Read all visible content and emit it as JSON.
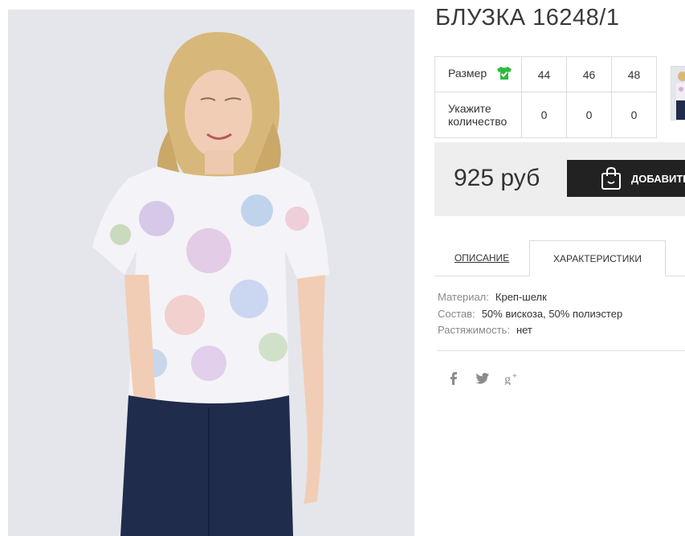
{
  "product": {
    "title": "БЛУЗКА 16248/1",
    "image_alt": "Женщина в блузке с цветочным принтом"
  },
  "sizes": {
    "size_label": "Размер",
    "quantity_label_line1": "Укажите",
    "quantity_label_line2": "количество",
    "values": [
      "44",
      "46",
      "48"
    ],
    "quantities": [
      "0",
      "0",
      "0"
    ],
    "icon": "tshirt-check-icon",
    "icon_color": "#2dbb3e"
  },
  "price": {
    "amount": "925 руб",
    "add_button_label": "ДОБАВИТЬ",
    "add_button_icon": "shopping-bag-icon"
  },
  "tabs": [
    {
      "label": "ОПИСАНИЕ",
      "active": false
    },
    {
      "label": "ХАРАКТЕРИСТИКИ",
      "active": true
    }
  ],
  "specs": [
    {
      "key": "Материал:",
      "value": "Креп-шелк"
    },
    {
      "key": "Состав:",
      "value": "50% вискоза, 50% полиэстер"
    },
    {
      "key": "Растяжимость:",
      "value": "нет"
    }
  ],
  "social": [
    "facebook-icon",
    "twitter-icon",
    "google-plus-icon"
  ],
  "colors": {
    "button_bg": "#222222",
    "price_box_bg": "#eeeeee",
    "accent_green": "#2dbb3e"
  }
}
